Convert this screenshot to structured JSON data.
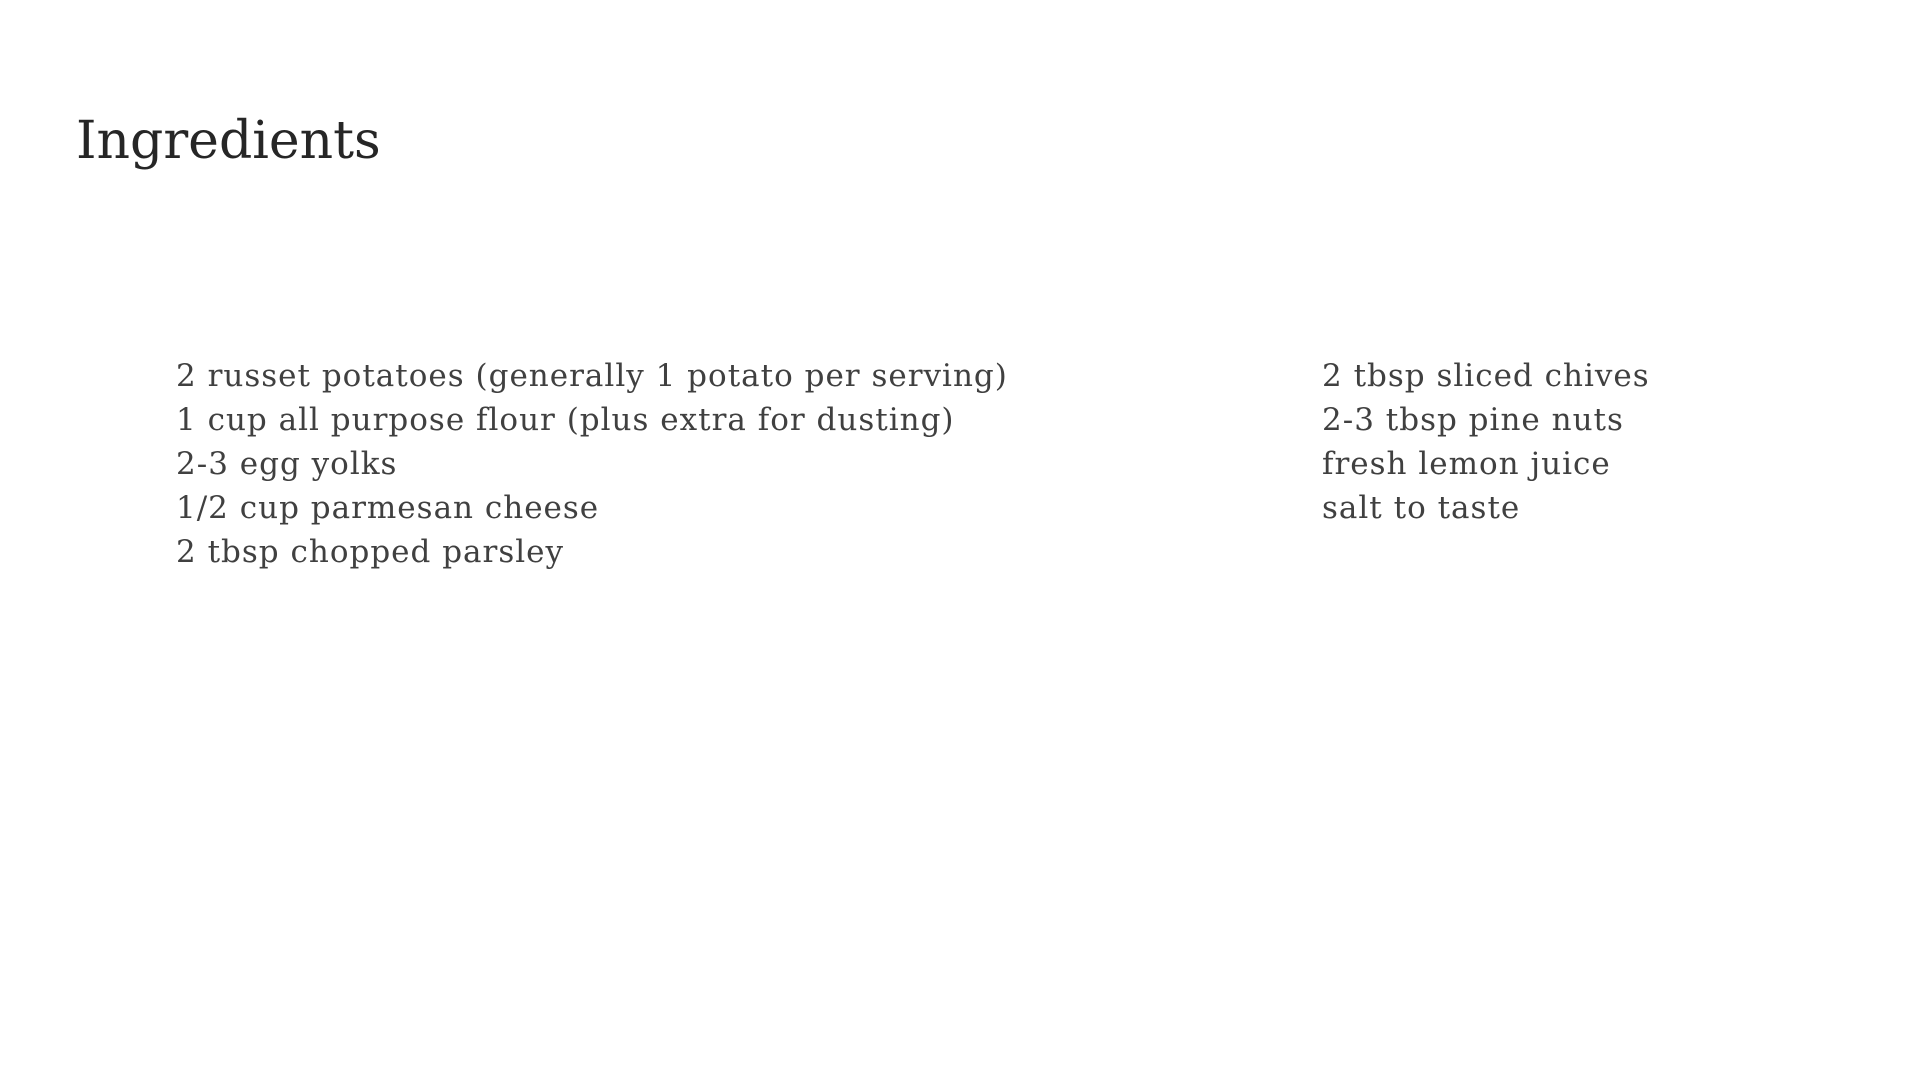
{
  "title": "Ingredients",
  "ingredients": {
    "left_column": [
      "2 russet potatoes (generally 1 potato per serving)",
      "1 cup all purpose flour (plus extra for dusting)",
      "2-3 egg yolks",
      "1/2 cup parmesan cheese",
      "2 tbsp chopped parsley"
    ],
    "right_column": [
      "2 tbsp sliced chives",
      "2-3 tbsp pine nuts",
      "fresh lemon juice",
      "salt to taste"
    ]
  },
  "colors": {
    "background": "#ffffff",
    "title_text": "#262626",
    "body_text": "#404040"
  }
}
